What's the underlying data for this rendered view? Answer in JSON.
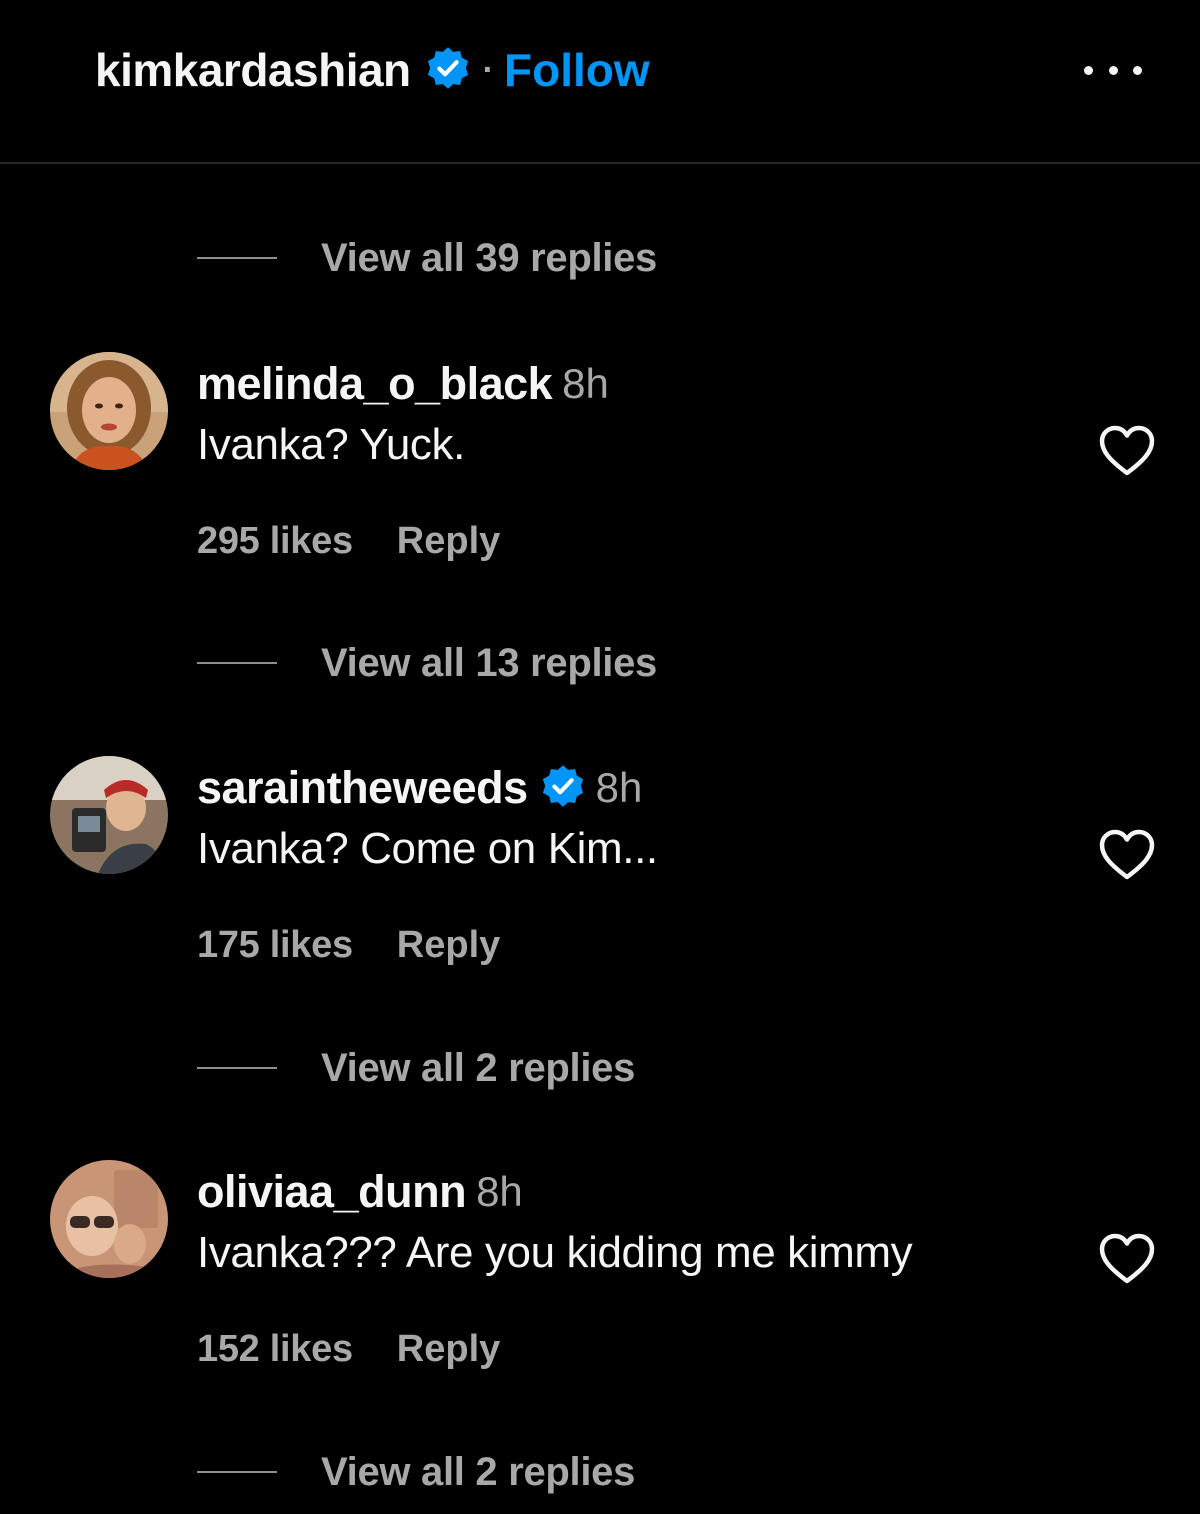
{
  "header": {
    "username": "kimkardashian",
    "separator": "·",
    "follow_label": "Follow",
    "more_icon": "more-horizontal-icon",
    "accent": "#0095f6"
  },
  "threads": [
    {
      "view_replies": "View all 39 replies"
    },
    {
      "username": "melinda_o_black",
      "verified": false,
      "time": "8h",
      "text": "Ivanka? Yuck.",
      "likes": "295 likes",
      "reply_label": "Reply",
      "view_replies": "View all 13 replies"
    },
    {
      "username": "saraintheweeds",
      "verified": true,
      "time": "8h",
      "text": "Ivanka? Come on Kim...",
      "likes": "175 likes",
      "reply_label": "Reply",
      "view_replies": "View all 2 replies"
    },
    {
      "username": "oliviaa_dunn",
      "verified": false,
      "time": "8h",
      "text": "Ivanka??? Are you kidding me kimmy",
      "likes": "152 likes",
      "reply_label": "Reply",
      "view_replies": "View all 2 replies"
    }
  ],
  "colors": {
    "background": "#000000",
    "text_primary": "#f5f5f5",
    "text_secondary": "#a8a8a8",
    "verified_badge": "#0095f6"
  }
}
